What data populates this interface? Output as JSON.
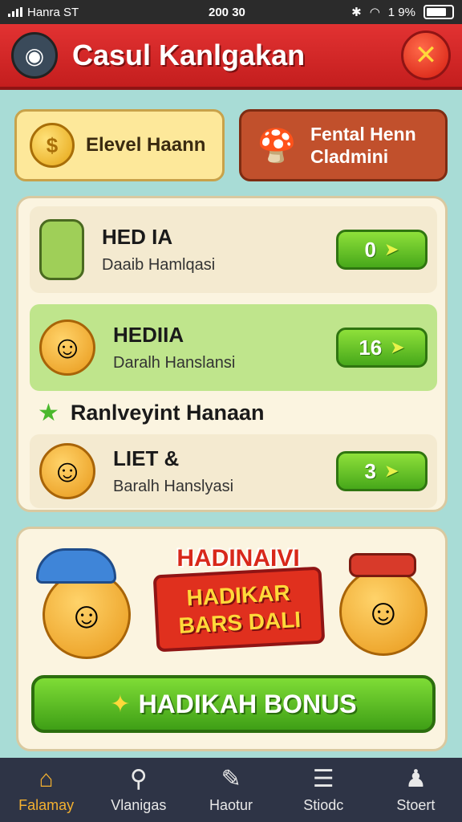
{
  "status_bar": {
    "carrier": "Hanra ST",
    "time": "200 30",
    "battery": "1 9%"
  },
  "header": {
    "title": "Casul Kanlgakan",
    "logo_icon": "gamepad-icon",
    "close_icon": "close-icon"
  },
  "top_cards": {
    "level_label": "Elevel Haann",
    "rental_label_line1": "Fental Henn",
    "rental_label_line2": "Cladmini"
  },
  "list": {
    "items": [
      {
        "title": "HED IA",
        "subtitle": "Daaib Hamlqasi",
        "value": "0",
        "icon": "bottle-icon"
      },
      {
        "title": "HEDIIA",
        "subtitle": "Daralh Hanslansi",
        "value": "16",
        "icon": "smiling-face-icon"
      }
    ],
    "section_label": "Ranlveyint Hanaan",
    "section_item": {
      "title": "LIET &",
      "subtitle": "Baralh Hanslyasi",
      "value": "3",
      "icon": "smiling-face-icon"
    }
  },
  "bonus": {
    "header": "HADINAIVI",
    "badge_line1": "HADIKAR",
    "badge_line2": "BARS DALI",
    "button_label": "HADIKAH BONUS"
  },
  "nav": {
    "items": [
      {
        "label": "Falamay",
        "icon": "home-icon",
        "active": true
      },
      {
        "label": "Vlanigas",
        "icon": "search-icon",
        "active": false
      },
      {
        "label": "Haotur",
        "icon": "edit-icon",
        "active": false
      },
      {
        "label": "Stiodc",
        "icon": "document-icon",
        "active": false
      },
      {
        "label": "Stoert",
        "icon": "profile-icon",
        "active": false
      }
    ]
  },
  "colors": {
    "header_red": "#d42828",
    "accent_green": "#5bb824",
    "nav_bg": "#2e3446",
    "nav_active": "#f3b030"
  }
}
